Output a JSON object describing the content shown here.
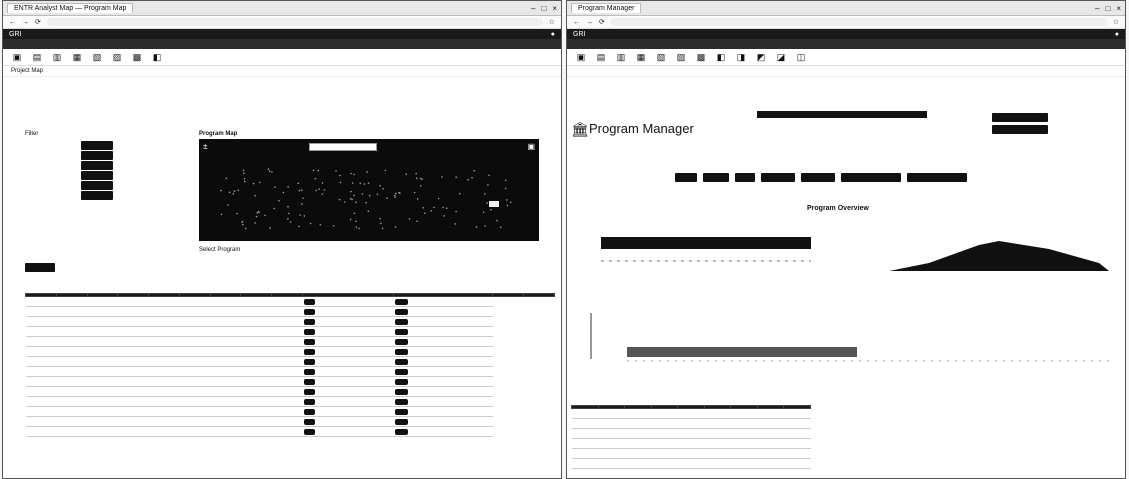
{
  "left": {
    "tab": "ENTR Analyst Map — Program Map",
    "url": "",
    "app_title": "GRI",
    "nav": [
      "",
      "",
      "",
      "",
      "",
      "",
      "",
      "",
      "",
      "",
      "",
      "",
      ""
    ],
    "nav_active": "",
    "crumb": "Project Map",
    "crumb_right": "",
    "filter_label": "Filter",
    "buttons": [
      "",
      "",
      "",
      "",
      "",
      ""
    ],
    "map_title": "Program Map",
    "popup": [
      "",
      "",
      ""
    ],
    "below_map": [
      "Select Program",
      "",
      ""
    ],
    "export_label": "",
    "table_title": "",
    "table_headers": [
      "",
      "",
      "",
      "",
      "",
      "",
      "",
      "",
      "",
      "",
      "",
      "",
      ""
    ],
    "rows": [
      [
        "",
        "",
        "",
        "",
        "",
        "",
        "",
        "",
        ""
      ],
      [
        "",
        "",
        "",
        "",
        "",
        "",
        "",
        "",
        ""
      ],
      [
        "",
        "",
        "",
        "",
        "",
        "",
        "",
        "",
        ""
      ],
      [
        "",
        "",
        "",
        "",
        "",
        "",
        "",
        "",
        ""
      ],
      [
        "",
        "",
        "",
        "",
        "",
        "",
        "",
        "",
        ""
      ],
      [
        "",
        "",
        "",
        "",
        "",
        "",
        "",
        "",
        ""
      ],
      [
        "",
        "",
        "",
        "",
        "",
        "",
        "",
        "",
        ""
      ],
      [
        "",
        "",
        "",
        "",
        "",
        "",
        "",
        "",
        ""
      ],
      [
        "",
        "",
        "",
        "",
        "",
        "",
        "",
        "",
        ""
      ],
      [
        "",
        "",
        "",
        "",
        "",
        "",
        "",
        "",
        ""
      ],
      [
        "",
        "",
        "",
        "",
        "",
        "",
        "",
        "",
        ""
      ],
      [
        "",
        "",
        "",
        "",
        "",
        "",
        "",
        "",
        ""
      ],
      [
        "",
        "",
        "",
        "",
        "",
        "",
        "",
        "",
        ""
      ],
      [
        "",
        "",
        "",
        "",
        "",
        "",
        "",
        "",
        ""
      ]
    ]
  },
  "right": {
    "tab": "Program Manager",
    "url": "",
    "nav": [
      "",
      "",
      "",
      "",
      "",
      "",
      "",
      "",
      "",
      "",
      "",
      ""
    ],
    "nav_active": "",
    "crumb": "",
    "crumb_right": "",
    "pm_title": "Program Manager",
    "selector_label": "",
    "info_lines": [
      "",
      "",
      "",
      ""
    ],
    "right_buttons": [
      "",
      ""
    ],
    "action_buttons": [
      "",
      "",
      "",
      "",
      "",
      "",
      ""
    ],
    "overview_title": "Program Overview",
    "chart1_title": "",
    "chart2_title": "",
    "chart3_title": "",
    "chart1_axis": "",
    "chart2_axis": "",
    "chart3_axis": "",
    "table_title": "",
    "table_headers": [
      "",
      "",
      "",
      "",
      "",
      "",
      "",
      "",
      ""
    ],
    "table_rows": [
      [
        "",
        "",
        "",
        "",
        "",
        "",
        "",
        "",
        ""
      ],
      [
        "",
        "",
        "",
        "",
        "",
        "",
        "",
        "",
        ""
      ],
      [
        "",
        "",
        "",
        "",
        "",
        "",
        "",
        "",
        ""
      ],
      [
        "",
        "",
        "",
        "",
        "",
        "",
        "",
        "",
        ""
      ],
      [
        "",
        "",
        "",
        "",
        "",
        "",
        "",
        "",
        ""
      ],
      [
        "",
        "",
        "",
        "",
        "",
        "",
        "",
        "",
        ""
      ]
    ]
  }
}
